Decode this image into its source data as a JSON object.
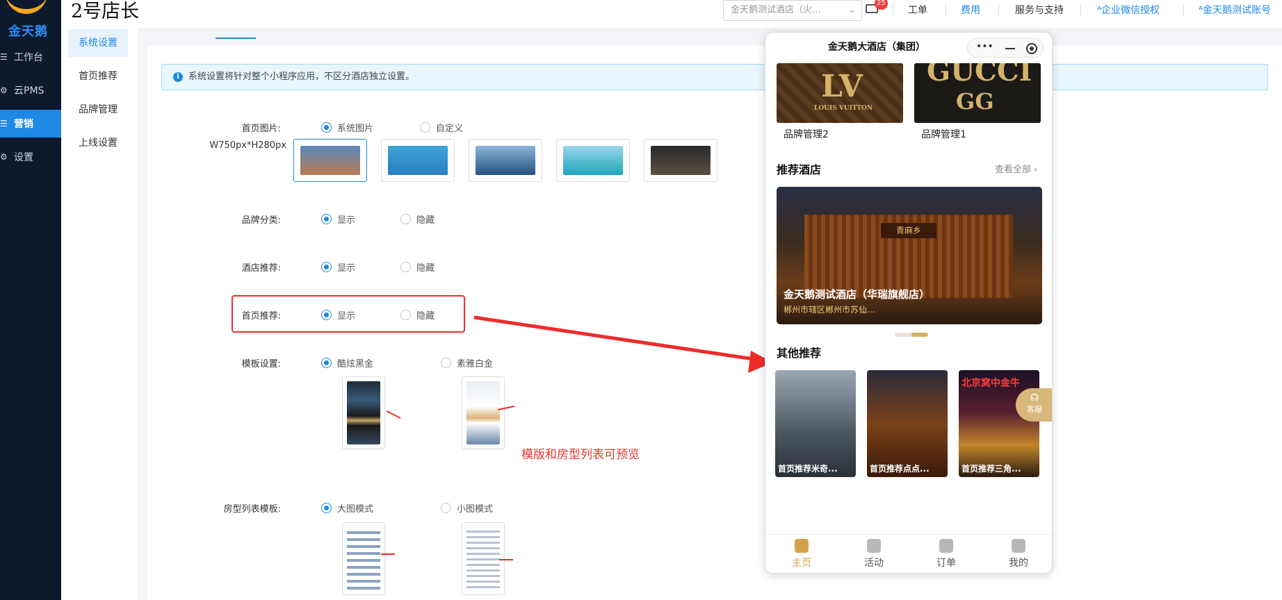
{
  "logo": {
    "text": "金天鹅"
  },
  "nav": [
    {
      "icon": "☰",
      "label": "工作台"
    },
    {
      "icon": "⚙",
      "label": "云PMS"
    },
    {
      "icon": "☰",
      "label": "营销"
    },
    {
      "icon": "⚙",
      "label": "设置"
    }
  ],
  "submenu": [
    "系统设置",
    "首页推荐",
    "品牌管理",
    "上线设置"
  ],
  "header": {
    "shop_title": "2号店长",
    "hotel_select": "金天鹅测试酒店（火...",
    "mail_count": "25",
    "links": [
      "工单",
      "费用",
      "服务与支持",
      "ᴬ企业微信授权",
      "ᴬ金天鹅测试账号"
    ]
  },
  "notice": "系统设置将针对整个小程序应用，不区分酒店独立设置。",
  "form": {
    "home_image_label": "首页图片:",
    "home_image_size": "W750px*H280px",
    "opt_system": "系统图片",
    "opt_custom": "自定义",
    "brand_label": "品牌分类:",
    "hotel_rec_label": "酒店推荐:",
    "home_rec_label": "首页推荐:",
    "show": "显示",
    "hide": "隐藏",
    "template_label": "模板设置:",
    "tpl_black": "酷炫黑金",
    "tpl_white": "素雅白金",
    "roomlist_label": "房型列表模板:",
    "big_mode": "大图模式",
    "small_mode": "小图模式",
    "note": "模版和房型列表可预览"
  },
  "phone": {
    "title": "金天鹅大酒店（集团）",
    "cap_dots": "•••",
    "brands": [
      {
        "logo": "LV",
        "sub": "LOUIS VUITTON",
        "name": "品牌管理2"
      },
      {
        "logo": "GUCCI",
        "sub": "GG",
        "name": "品牌管理1"
      }
    ],
    "rec_hotel_title": "推荐酒店",
    "see_all": "查看全部 ›",
    "hotel_sign": "青麻乡",
    "hotel_name": "金天鹅测试酒店（华瑞旗舰店）",
    "hotel_addr": "郴州市辖区郴州市苏仙...",
    "other_title": "其他推荐",
    "others": [
      "首页推荐米奇...",
      "首页推荐点点...",
      "首页推荐三角..."
    ],
    "other_sign": "北京窝中金牛",
    "kefu": "客服",
    "tabs": [
      "主页",
      "活动",
      "订单",
      "我的"
    ]
  },
  "colors": {
    "accent": "#1e88e5",
    "nav_bg": "#0d1a2e",
    "highlight": "#ee2b2b",
    "gold": "#d4a14a"
  }
}
